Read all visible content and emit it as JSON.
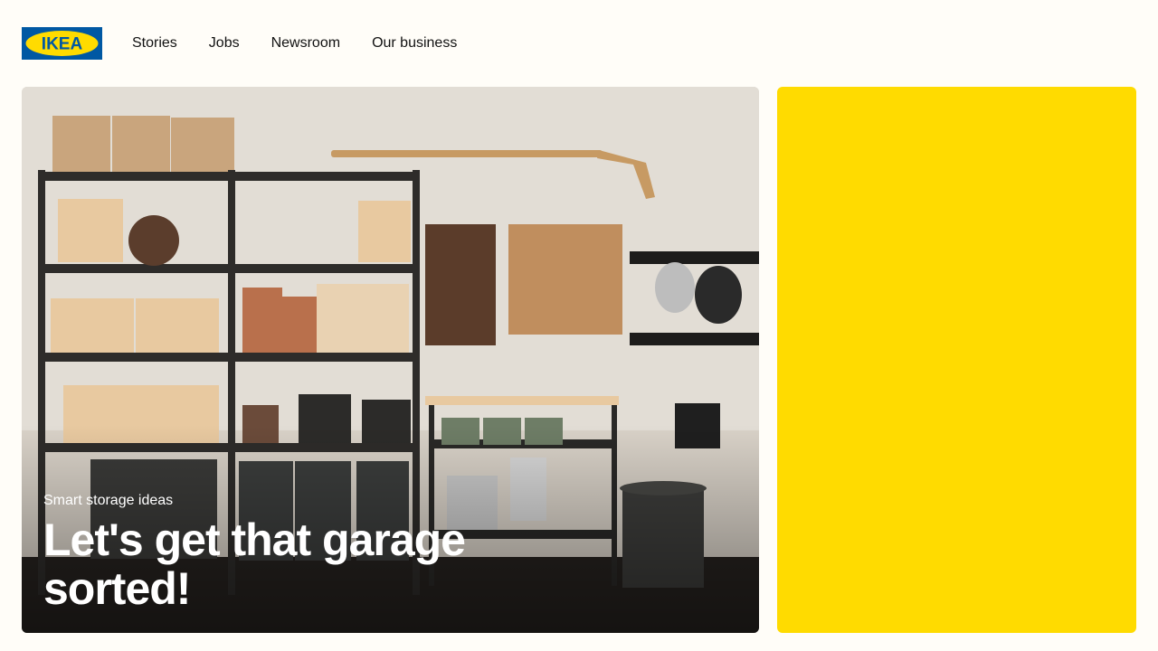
{
  "header": {
    "logo_text": "IKEA",
    "nav": [
      {
        "label": "Stories"
      },
      {
        "label": "Jobs"
      },
      {
        "label": "Newsroom"
      },
      {
        "label": "Our business"
      }
    ]
  },
  "hero": {
    "eyebrow": "Smart storage ideas",
    "headline": "Let's get that garage sorted!"
  },
  "colors": {
    "brand_blue": "#0058a3",
    "brand_yellow": "#ffdb00",
    "page_background": "#fffdf8"
  }
}
